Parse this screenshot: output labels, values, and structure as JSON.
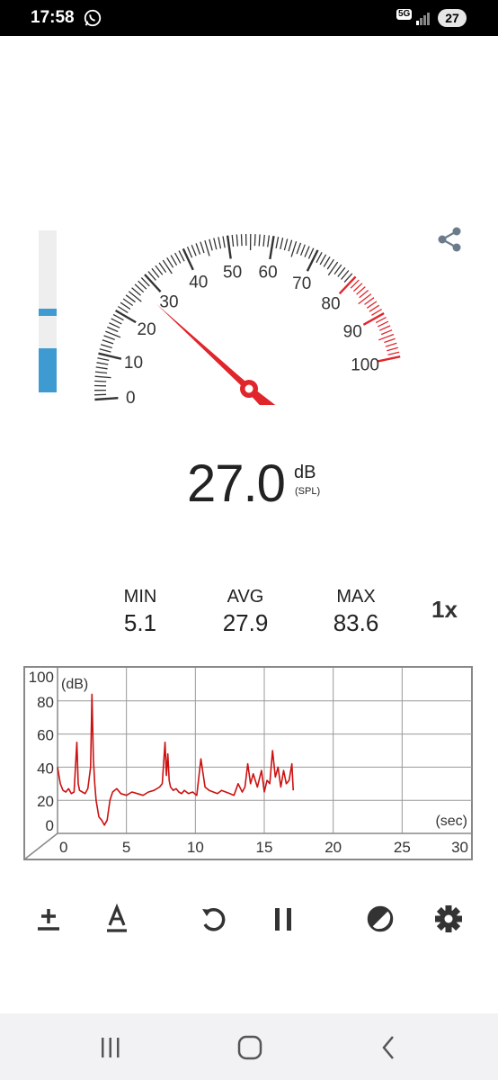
{
  "status_bar": {
    "time": "17:58",
    "network": "5G",
    "battery": "27",
    "icons": [
      "whatsapp-icon",
      "signal-icon",
      "battery-icon"
    ]
  },
  "meter": {
    "level_fraction": 0.27,
    "peak_fraction": 0.47,
    "scale_labels": [
      "0",
      "10",
      "20",
      "30",
      "40",
      "50",
      "60",
      "70",
      "80",
      "90",
      "100"
    ],
    "needle_value": 27.0,
    "accent_color": "#e0252b",
    "level_color": "#3d9bd1"
  },
  "reading": {
    "value": "27.0",
    "unit": "dB",
    "unit_sub": "(SPL)"
  },
  "stats": {
    "min_label": "MIN",
    "min_value": "5.1",
    "avg_label": "AVG",
    "avg_value": "27.9",
    "max_label": "MAX",
    "max_value": "83.6",
    "speed": "1x"
  },
  "chart_data": {
    "type": "line",
    "xlabel": "(sec)",
    "ylabel": "(dB)",
    "xlim": [
      0,
      30
    ],
    "ylim": [
      0,
      100
    ],
    "x_ticks": [
      "0",
      "5",
      "10",
      "15",
      "20",
      "25",
      "30"
    ],
    "y_ticks": [
      "0",
      "20",
      "40",
      "60",
      "80",
      "100"
    ],
    "grid": true,
    "series_color": "#cc1111",
    "x": [
      0,
      0.2,
      0.4,
      0.6,
      0.8,
      1.0,
      1.2,
      1.4,
      1.5,
      1.6,
      1.8,
      2.0,
      2.2,
      2.4,
      2.5,
      2.6,
      2.7,
      2.8,
      3.0,
      3.2,
      3.4,
      3.6,
      3.8,
      4.0,
      4.3,
      4.6,
      5.0,
      5.4,
      5.8,
      6.2,
      6.6,
      7.0,
      7.4,
      7.6,
      7.8,
      7.9,
      8.0,
      8.1,
      8.2,
      8.4,
      8.6,
      8.8,
      9.0,
      9.2,
      9.5,
      9.8,
      10.1,
      10.4,
      10.7,
      11.0,
      11.3,
      11.6,
      11.9,
      12.2,
      12.5,
      12.8,
      13.1,
      13.4,
      13.6,
      13.8,
      14.0,
      14.2,
      14.5,
      14.8,
      15.0,
      15.2,
      15.4,
      15.6,
      15.8,
      16.0,
      16.2,
      16.4,
      16.6,
      16.8,
      17.0,
      17.1
    ],
    "y": [
      40,
      30,
      26,
      25,
      27,
      24,
      25,
      55,
      30,
      26,
      25,
      24,
      27,
      40,
      84,
      45,
      30,
      20,
      10,
      8,
      5,
      8,
      20,
      25,
      27,
      24,
      23,
      25,
      24,
      23,
      25,
      26,
      28,
      30,
      55,
      35,
      48,
      32,
      28,
      26,
      27,
      25,
      24,
      26,
      24,
      25,
      23,
      45,
      28,
      26,
      25,
      24,
      26,
      25,
      24,
      23,
      30,
      25,
      28,
      42,
      30,
      36,
      28,
      38,
      25,
      32,
      30,
      50,
      34,
      40,
      28,
      38,
      30,
      32,
      42,
      26
    ]
  },
  "toolbar": {
    "icons": [
      "calibration-icon",
      "weighting-icon",
      "reset-icon",
      "pause-icon",
      "theme-icon",
      "settings-icon"
    ]
  },
  "navbar": {
    "icons": [
      "recent-apps-icon",
      "home-icon",
      "back-icon"
    ]
  }
}
